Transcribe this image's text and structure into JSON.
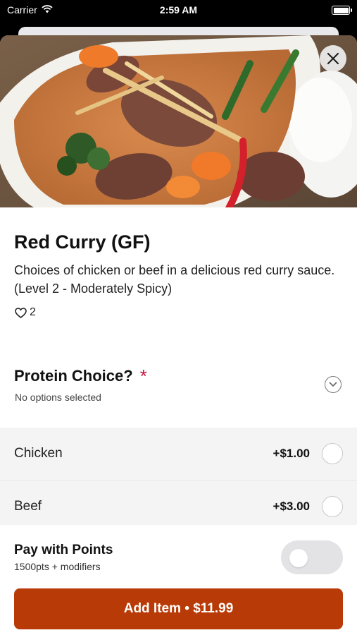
{
  "status_bar": {
    "carrier": "Carrier",
    "time": "2:59 AM"
  },
  "item": {
    "title": "Red Curry (GF)",
    "description": "Choices of chicken or beef in a delicious red curry sauce. (Level 2 - Moderately Spicy)",
    "likes": "2"
  },
  "protein": {
    "title": "Protein Choice?",
    "required_mark": "*",
    "subtitle": "No options selected",
    "options": [
      {
        "label": "Chicken",
        "price": "+$1.00"
      },
      {
        "label": "Beef",
        "price": "+$3.00"
      }
    ]
  },
  "points": {
    "title": "Pay with Points",
    "subtitle": "1500pts + modifiers",
    "enabled": false
  },
  "add_button": {
    "label": "Add Item • $11.99"
  },
  "colors": {
    "accent": "#b83a06",
    "required": "#c8123e"
  }
}
